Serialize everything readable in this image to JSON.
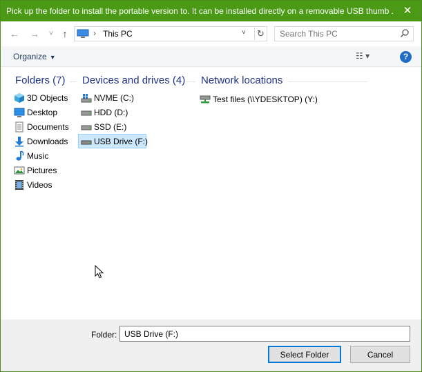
{
  "window": {
    "title": "Pick up the folder to install the portable version to. It can be installed directly on a removable USB thumb ...",
    "close_glyph": "✕",
    "accent_color": "#4b9a15"
  },
  "nav": {
    "back_glyph": "←",
    "forward_glyph": "→",
    "recent_glyph": "˅",
    "up_glyph": "↑",
    "address_separator": "›",
    "address_path": "This PC",
    "address_dropdown_glyph": "˅",
    "refresh_glyph": "↻",
    "search_placeholder": "Search This PC"
  },
  "toolbar": {
    "organize_label": "Organize",
    "organize_caret": "▼",
    "view_glyph": "☷ ▾",
    "help_glyph": "?"
  },
  "groups": {
    "folders": {
      "header": "Folders (7)",
      "items": [
        {
          "label": "3D Objects",
          "icon": "3d-objects-icon"
        },
        {
          "label": "Desktop",
          "icon": "desktop-icon"
        },
        {
          "label": "Documents",
          "icon": "documents-icon"
        },
        {
          "label": "Downloads",
          "icon": "downloads-icon"
        },
        {
          "label": "Music",
          "icon": "music-icon"
        },
        {
          "label": "Pictures",
          "icon": "pictures-icon"
        },
        {
          "label": "Videos",
          "icon": "videos-icon"
        }
      ]
    },
    "drives": {
      "header": "Devices and drives (4)",
      "items": [
        {
          "label": "NVME (C:)",
          "icon": "windows-drive-icon"
        },
        {
          "label": "HDD (D:)",
          "icon": "drive-icon"
        },
        {
          "label": "SSD (E:)",
          "icon": "drive-icon"
        },
        {
          "label": "USB Drive (F:)",
          "icon": "usb-drive-icon",
          "selected": true
        }
      ]
    },
    "network": {
      "header": "Network locations",
      "items": [
        {
          "label": "Test files (\\\\YDESKTOP) (Y:)",
          "icon": "network-drive-icon"
        }
      ]
    }
  },
  "footer": {
    "folder_label": "Folder:",
    "folder_value": "USB Drive (F:)",
    "select_button": "Select Folder",
    "cancel_button": "Cancel"
  },
  "colors": {
    "group_header": "#1e3287",
    "selection_bg": "#cce8ff",
    "selection_border": "#99d1ff",
    "primary_button_border": "#0078d7"
  }
}
